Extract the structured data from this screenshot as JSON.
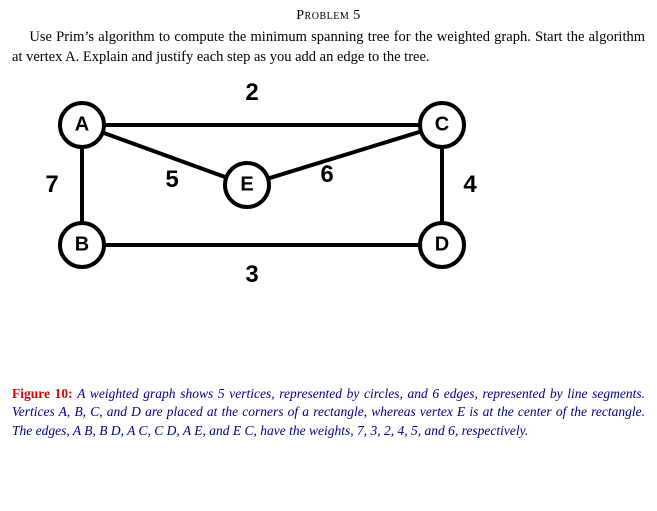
{
  "heading": "Problem 5",
  "prompt": "Use Prim’s algorithm to compute the minimum spanning tree for the weighted graph. Start the algorithm at vertex A. Explain and justify each step as you add an edge to the tree.",
  "graph": {
    "vertices": {
      "A": "A",
      "B": "B",
      "C": "C",
      "D": "D",
      "E": "E"
    },
    "edges": [
      {
        "endpoints": [
          "A",
          "B"
        ],
        "weight": "7"
      },
      {
        "endpoints": [
          "B",
          "D"
        ],
        "weight": "3"
      },
      {
        "endpoints": [
          "A",
          "C"
        ],
        "weight": "2"
      },
      {
        "endpoints": [
          "C",
          "D"
        ],
        "weight": "4"
      },
      {
        "endpoints": [
          "A",
          "E"
        ],
        "weight": "5"
      },
      {
        "endpoints": [
          "E",
          "C"
        ],
        "weight": "6"
      }
    ]
  },
  "weight_labels": {
    "AC": "2",
    "CD": "4",
    "BD": "3",
    "AB": "7",
    "AE": "5",
    "EC": "6"
  },
  "caption": {
    "label": "Figure 10:",
    "text": "A weighted graph shows 5 vertices, represented by circles, and 6 edges, represented by line segments. Vertices A, B, C, and D are placed at the corners of a rectangle, whereas vertex E is at the center of the rectangle. The edges, A B, B D, A C, C D, A E, and E C, have the weights, 7, 3, 2, 4, 5, and 6, respectively."
  }
}
